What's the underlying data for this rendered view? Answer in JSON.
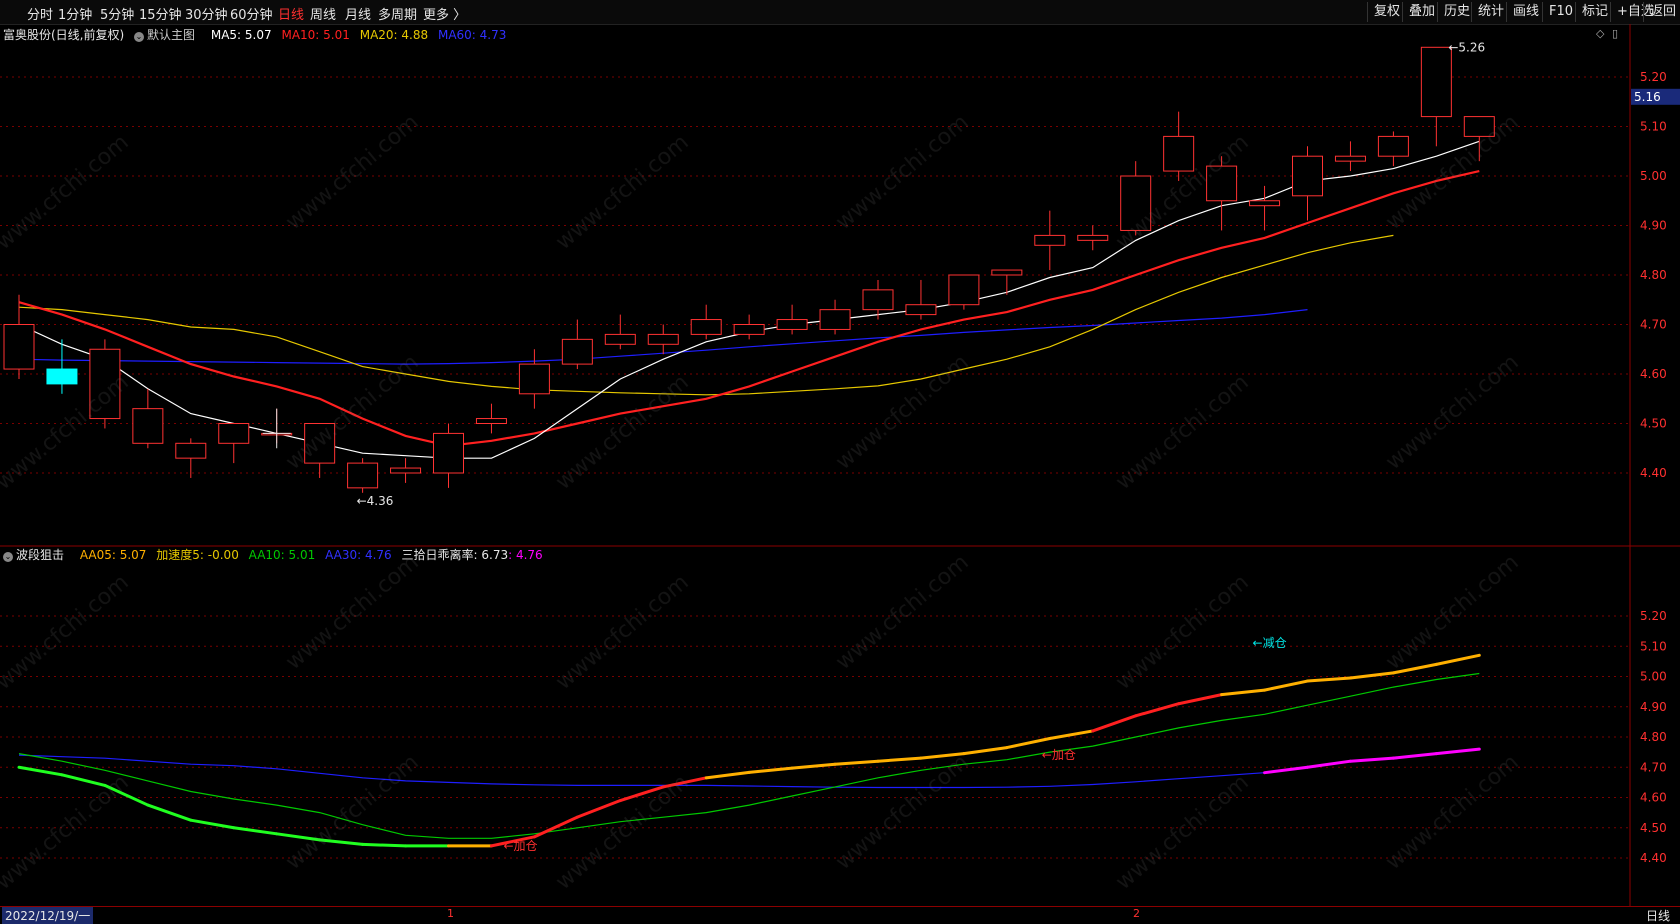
{
  "toolbar": {
    "periods": [
      {
        "label": "分时",
        "active": false
      },
      {
        "label": "1分钟",
        "active": false
      },
      {
        "label": "5分钟",
        "active": false
      },
      {
        "label": "15分钟",
        "active": false
      },
      {
        "label": "30分钟",
        "active": false
      },
      {
        "label": "60分钟",
        "active": false
      },
      {
        "label": "日线",
        "active": true
      },
      {
        "label": "周线",
        "active": false
      },
      {
        "label": "月线",
        "active": false
      },
      {
        "label": "多周期",
        "active": false
      },
      {
        "label": "更多 〉",
        "active": false
      }
    ],
    "right": [
      "复权",
      "叠加",
      "历史",
      "统计",
      "画线",
      "F10",
      "标记",
      "+自选",
      "返回"
    ]
  },
  "main_info": {
    "stock": "富奥股份(日线,前复权)",
    "template": "默认主图",
    "ma5": "MA5: 5.07",
    "ma10": "MA10: 5.01",
    "ma20": "MA20: 4.88",
    "ma60": "MA60: 4.73"
  },
  "sub_info": {
    "name": "波段狙击",
    "aa05": "AA05: 5.07",
    "accel": "加速度5: -0.00",
    "aa10": "AA10: 5.01",
    "aa30": "AA30: 4.76",
    "dev_label": "三拾日乖离率: 6.73",
    "dev_val": ": 4.76"
  },
  "price_tag": "5.16",
  "high_marker": "5.26",
  "low_marker": "4.36",
  "sub_annotations": [
    "←加仓",
    "←加仓",
    "←减仓"
  ],
  "bottom": {
    "date": "2022/12/19/一",
    "m1": "1",
    "m2": "2",
    "period": "日线"
  },
  "watermark": "www.cfchi.com",
  "colors": {
    "up": "#ff3232",
    "down": "#00ffff",
    "ma5": "#ffffff",
    "ma10": "#ff2020",
    "ma20": "#e6c800",
    "ma60": "#1e1eff",
    "aa05": "#ffb000",
    "aa10": "#00c800",
    "aa30": "#1e1eff",
    "dev": "#ff00ff"
  },
  "chart_data": [
    {
      "type": "candlestick",
      "title": "富奥股份(日线,前复权)",
      "y_ticks": [
        4.4,
        4.5,
        4.6,
        4.7,
        4.8,
        4.9,
        5.0,
        5.1,
        5.2
      ],
      "ylim": [
        4.31,
        5.31
      ],
      "candles": [
        {
          "o": 4.61,
          "c": 4.7,
          "h": 4.76,
          "l": 4.59
        },
        {
          "o": 4.61,
          "c": 4.58,
          "h": 4.67,
          "l": 4.56
        },
        {
          "o": 4.51,
          "c": 4.65,
          "h": 4.67,
          "l": 4.49
        },
        {
          "o": 4.46,
          "c": 4.53,
          "h": 4.57,
          "l": 4.45
        },
        {
          "o": 4.43,
          "c": 4.46,
          "h": 4.47,
          "l": 4.39
        },
        {
          "o": 4.46,
          "c": 4.5,
          "h": 4.5,
          "l": 4.42
        },
        {
          "o": 4.48,
          "c": 4.48,
          "h": 4.53,
          "l": 4.46
        },
        {
          "o": 4.42,
          "c": 4.5,
          "h": 4.5,
          "l": 4.39
        },
        {
          "o": 4.37,
          "c": 4.42,
          "h": 4.43,
          "l": 4.36
        },
        {
          "o": 4.4,
          "c": 4.41,
          "h": 4.43,
          "l": 4.38
        },
        {
          "o": 4.4,
          "c": 4.48,
          "h": 4.5,
          "l": 4.37
        },
        {
          "o": 4.5,
          "c": 4.51,
          "h": 4.54,
          "l": 4.48
        },
        {
          "o": 4.56,
          "c": 4.62,
          "h": 4.65,
          "l": 4.53
        },
        {
          "o": 4.62,
          "c": 4.67,
          "h": 4.71,
          "l": 4.61
        },
        {
          "o": 4.66,
          "c": 4.68,
          "h": 4.72,
          "l": 4.65
        },
        {
          "o": 4.66,
          "c": 4.68,
          "h": 4.7,
          "l": 4.64
        },
        {
          "o": 4.68,
          "c": 4.71,
          "h": 4.74,
          "l": 4.67
        },
        {
          "o": 4.68,
          "c": 4.7,
          "h": 4.72,
          "l": 4.67
        },
        {
          "o": 4.69,
          "c": 4.71,
          "h": 4.74,
          "l": 4.68
        },
        {
          "o": 4.69,
          "c": 4.73,
          "h": 4.75,
          "l": 4.68
        },
        {
          "o": 4.73,
          "c": 4.77,
          "h": 4.79,
          "l": 4.71
        },
        {
          "o": 4.72,
          "c": 4.74,
          "h": 4.79,
          "l": 4.71
        },
        {
          "o": 4.74,
          "c": 4.8,
          "h": 4.8,
          "l": 4.73
        },
        {
          "o": 4.8,
          "c": 4.81,
          "h": 4.81,
          "l": 4.76
        },
        {
          "o": 4.86,
          "c": 4.88,
          "h": 4.93,
          "l": 4.81
        },
        {
          "o": 4.87,
          "c": 4.88,
          "h": 4.9,
          "l": 4.85
        },
        {
          "o": 4.89,
          "c": 5.0,
          "h": 5.03,
          "l": 4.88
        },
        {
          "o": 5.01,
          "c": 5.08,
          "h": 5.13,
          "l": 4.99
        },
        {
          "o": 4.95,
          "c": 5.02,
          "h": 5.04,
          "l": 4.89
        },
        {
          "o": 4.94,
          "c": 4.95,
          "h": 4.98,
          "l": 4.89
        },
        {
          "o": 4.96,
          "c": 5.04,
          "h": 5.06,
          "l": 4.91
        },
        {
          "o": 5.03,
          "c": 5.04,
          "h": 5.07,
          "l": 5.01
        },
        {
          "o": 5.04,
          "c": 5.08,
          "h": 5.09,
          "l": 5.02
        },
        {
          "o": 5.12,
          "c": 5.26,
          "h": 5.26,
          "l": 5.06
        },
        {
          "o": 5.08,
          "c": 5.12,
          "h": 5.12,
          "l": 5.03
        }
      ],
      "series": [
        {
          "name": "MA5",
          "values": [
            4.7,
            4.66,
            4.63,
            4.57,
            4.52,
            4.5,
            4.48,
            4.46,
            4.44,
            4.435,
            4.43,
            4.43,
            4.47,
            4.53,
            4.59,
            4.63,
            4.665,
            4.685,
            4.7,
            4.71,
            4.72,
            4.73,
            4.745,
            4.765,
            4.795,
            4.815,
            4.87,
            4.91,
            4.94,
            4.955,
            4.99,
            5.0,
            5.015,
            5.04,
            5.07
          ]
        },
        {
          "name": "MA10",
          "values": [
            4.745,
            4.72,
            4.69,
            4.655,
            4.62,
            4.595,
            4.575,
            4.55,
            4.51,
            4.475,
            4.455,
            4.465,
            4.48,
            4.5,
            4.52,
            4.535,
            4.55,
            4.575,
            4.605,
            4.635,
            4.665,
            4.69,
            4.71,
            4.725,
            4.75,
            4.77,
            4.8,
            4.83,
            4.855,
            4.875,
            4.905,
            4.935,
            4.965,
            4.99,
            5.01
          ]
        },
        {
          "name": "MA20",
          "values": [
            4.735,
            4.73,
            4.72,
            4.71,
            4.695,
            4.69,
            4.675,
            4.645,
            4.615,
            4.6,
            4.585,
            4.575,
            4.568,
            4.565,
            4.562,
            4.56,
            4.558,
            4.56,
            4.565,
            4.57,
            4.576,
            4.59,
            4.61,
            4.63,
            4.655,
            4.69,
            4.73,
            4.765,
            4.795,
            4.82,
            4.845,
            4.865,
            4.88
          ]
        },
        {
          "name": "MA60",
          "values": [
            4.63,
            4.628,
            4.627,
            4.626,
            4.625,
            4.624,
            4.623,
            4.622,
            4.621,
            4.62,
            4.621,
            4.623,
            4.626,
            4.63,
            4.636,
            4.642,
            4.648,
            4.655,
            4.661,
            4.667,
            4.673,
            4.678,
            4.684,
            4.689,
            4.694,
            4.698,
            4.703,
            4.708,
            4.713,
            4.72,
            4.73
          ]
        }
      ]
    },
    {
      "type": "line",
      "title": "波段狙击",
      "y_ticks": [
        4.4,
        4.5,
        4.6,
        4.7,
        4.8,
        4.9,
        5.0,
        5.1,
        5.2
      ],
      "ylim": [
        4.31,
        5.31
      ],
      "series": [
        {
          "name": "AA05",
          "values": [
            4.7,
            4.675,
            4.64,
            4.575,
            4.525,
            4.5,
            4.48,
            4.46,
            4.445,
            4.44,
            4.44,
            4.44,
            4.47,
            4.535,
            4.59,
            4.635,
            4.665,
            4.683,
            4.697,
            4.71,
            4.72,
            4.73,
            4.745,
            4.765,
            4.795,
            4.82,
            4.87,
            4.91,
            4.94,
            4.955,
            4.985,
            4.995,
            5.012,
            5.04,
            5.07
          ]
        },
        {
          "name": "AA10",
          "values": [
            4.745,
            4.72,
            4.69,
            4.655,
            4.62,
            4.595,
            4.575,
            4.55,
            4.51,
            4.475,
            4.465,
            4.465,
            4.48,
            4.5,
            4.52,
            4.535,
            4.55,
            4.575,
            4.605,
            4.635,
            4.665,
            4.69,
            4.71,
            4.725,
            4.75,
            4.77,
            4.8,
            4.83,
            4.855,
            4.875,
            4.905,
            4.935,
            4.965,
            4.99,
            5.01
          ]
        },
        {
          "name": "AA30",
          "values": [
            4.74,
            4.735,
            4.73,
            4.72,
            4.71,
            4.705,
            4.695,
            4.68,
            4.665,
            4.655,
            4.65,
            4.645,
            4.642,
            4.64,
            4.64,
            4.64,
            4.64,
            4.638,
            4.636,
            4.634,
            4.633,
            4.633,
            4.633,
            4.634,
            4.637,
            4.643,
            4.652,
            4.662,
            4.672,
            4.682,
            4.7,
            4.72,
            4.73,
            4.745,
            4.76
          ]
        }
      ]
    }
  ]
}
